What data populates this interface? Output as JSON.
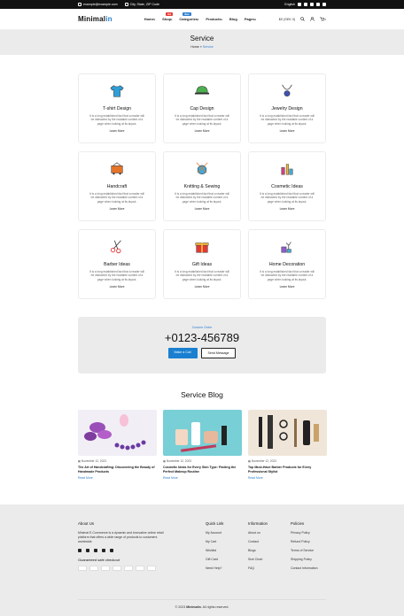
{
  "topbar": {
    "email": "example@example.com",
    "address": "City, State, ZIP Code",
    "language": "English"
  },
  "nav": {
    "logo_main": "Minimal",
    "logo_accent": "in",
    "items": [
      {
        "label": "Home",
        "arrow": "▾"
      },
      {
        "label": "Shop",
        "arrow": "▾",
        "badge": "Hot",
        "badge_color": "#e53935"
      },
      {
        "label": "Categories",
        "arrow": "▾",
        "badge": "New",
        "badge_color": "#2f80d0"
      },
      {
        "label": "Products",
        "arrow": "▾"
      },
      {
        "label": "Blog",
        "arrow": ""
      },
      {
        "label": "Pages",
        "arrow": "▾"
      }
    ],
    "currency": "$0 (SEK 0)",
    "cart_count": "0"
  },
  "hero": {
    "title": "Service",
    "crumb_home": "Home",
    "crumb_sep": "»",
    "crumb_current": "Service"
  },
  "services": [
    {
      "title": "T-shirt Design",
      "desc": "It is a long established fact that a reader will be distracted by the readable content of a page when looking at its layout.",
      "link": "Learn More",
      "icon": "tshirt-icon",
      "color": "#2f9fd8"
    },
    {
      "title": "Cap Design",
      "desc": "It is a long established fact that a reader will be distracted by the readable content of a page when looking at its layout.",
      "link": "Learn More",
      "icon": "cap-icon",
      "color": "#4caf50"
    },
    {
      "title": "Jewelry Design",
      "desc": "It is a long established fact that a reader will be distracted by the readable content of a page when looking at its layout.",
      "link": "Learn More",
      "icon": "necklace-icon",
      "color": "#3f51b5"
    },
    {
      "title": "Handcraft",
      "desc": "It is a long established fact that a reader will be distracted by the readable content of a page when looking at its layout.",
      "link": "Learn More",
      "icon": "handcraft-icon",
      "color": "#e57328"
    },
    {
      "title": "Knitting & Sewing",
      "desc": "It is a long established fact that a reader will be distracted by the readable content of a page when looking at its layout.",
      "link": "Learn More",
      "icon": "yarn-icon",
      "color": "#43a9d6"
    },
    {
      "title": "Cosmetic Ideas",
      "desc": "It is a long established fact that a reader will be distracted by the readable content of a page when looking at its layout.",
      "link": "Learn More",
      "icon": "cosmetic-icon",
      "color": "#d0407e"
    },
    {
      "title": "Barber Ideas",
      "desc": "It is a long established fact that a reader will be distracted by the readable content of a page when looking at its layout.",
      "link": "Learn More",
      "icon": "scissors-icon",
      "color": "#e53935"
    },
    {
      "title": "Gift Ideas",
      "desc": "It is a long established fact that a reader will be distracted by the readable content of a page when looking at its layout.",
      "link": "Learn More",
      "icon": "gift-icon",
      "color": "#e53935"
    },
    {
      "title": "Home Decoration",
      "desc": "It is a long established fact that a reader will be distracted by the readable content of a page when looking at its layout.",
      "link": "Learn More",
      "icon": "home-decor-icon",
      "color": "#8e5cc9"
    }
  ],
  "contact": {
    "label": "Custom Order",
    "phone": "+0123-456789",
    "primary": "Make a Call",
    "secondary": "Send Message"
  },
  "blog": {
    "title": "Service Blog",
    "posts": [
      {
        "date": "November 12, 2023",
        "title": "The Art of Handcrafting: Discovering the Beauty of Handmade Products",
        "link": "Read More",
        "image": "flowers-beads-image"
      },
      {
        "date": "November 12, 2023",
        "title": "Cosmetic Ideas for Every Skin Type: Finding the Perfect Makeup Routine",
        "link": "Read More",
        "image": "makeup-image"
      },
      {
        "date": "November 12, 2023",
        "title": "Top Must-Have Barber Products for Every Professional Stylist",
        "link": "Read More",
        "image": "barber-tools-image"
      }
    ]
  },
  "footer": {
    "about_title": "About Us",
    "about_text": "Minimal E-Commerce is a dynamic and innovative online retail platform that offers a wide range of products to customers worldwide.",
    "safe_checkout": "Guaranteed safe checkout",
    "quick_title": "Quick Link",
    "quick": [
      "My Account",
      "My Cart",
      "Wishlist",
      "Gift Card",
      "Need Help?"
    ],
    "info_title": "Information",
    "info": [
      "About us",
      "Contact",
      "Blogs",
      "Size Chart",
      "FAQ"
    ],
    "policy_title": "Policies",
    "policies": [
      "Privacy Policy",
      "Refund Policy",
      "Terms of Service",
      "Shipping Policy",
      "Contact Information"
    ],
    "copyright_prefix": "© 2023",
    "copyright_brand": "Minimalin",
    "copyright_suffix": ". All rights reserved."
  }
}
